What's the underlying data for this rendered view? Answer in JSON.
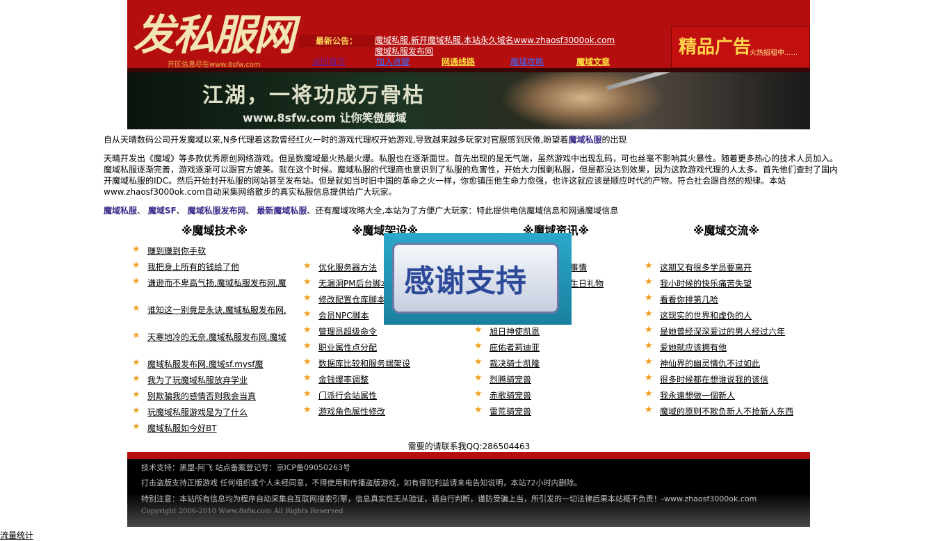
{
  "header": {
    "logo_text": "发私服网",
    "logo_sub": "开区信息尽在www.8sfw.com",
    "notice_label": "最新公告：",
    "notice_line1": "魔域私服,新开魔域私服,本站永久域名www.zhaosf3000ok.com",
    "notice_line2": "魔域私服发布网",
    "nav": [
      "返回首页",
      "加入收藏",
      "网通线路",
      "魔域攻略",
      "魔域文章"
    ],
    "ad_text": "精品广告",
    "ad_sub": "火热招租中......"
  },
  "banner": {
    "title": "江湖，一将功成万骨枯",
    "subtitle": "www.8sfw.com 让你笑傲魔域"
  },
  "intro": {
    "line1": "自从天晴数码公司开发魔域以来,N多代理着这款曾经红火一时的游戏代理权开始游戏,导致越来越多玩家对官服感到厌倦,盼望着",
    "line1_link": "魔域私服",
    "line1_end": "的出现",
    "para2": "天晴开发出《魔域》等多款优秀原创网络游戏。但是数魔域最火热最火爆。私服也在逐渐面世。首先出现的是无气端，虽然游戏中出现乱码，可也丝毫不影响其火暴性。随着更多热心的技术人员加入。魔域私服逐渐完善，游戏逐渐可以跟官方媲美。就在这个时候。魔域私服的代理商也意识到了私服的危害性，开始大力围剿私服，但是都没达到效果，因为这款游戏代理的人太多。首先他们查封了国内开魔域私服的IDC。然后开始封开私服的网站甚至发布站。但是就如当时旧中国的革命之火一样，你愈镇压他生命力愈强，也许这就应该是顺应时代的产物。符合社会跟自然的规律。本站www.zhaosf3000ok.com自动采集网络散步的真实私服信息提供给广大玩家。"
  },
  "links_line": {
    "l1": "魔域私服",
    "l2": "魔域SF",
    "l3": "魔域私服发布网",
    "l4": "最新魔域私服",
    "mid": "、还有",
    "l5": "魔域攻略",
    "end": "大全,本站为了方便广大玩家：特此提供电信魔域信息和网通魔域信息"
  },
  "columns": [
    {
      "title": "※魔域技术※",
      "items": [
        "赚到赚到你手软",
        "我把身上所有的钱给了他",
        "谦逊而不卑高气扬,魔域私服发布网,魔",
        "谁知这一别竟是永诀,魔域私服发布网,",
        "天寒地冷的无奈,魔域私服发布网,魔域",
        "魔域私服发布网,魔域sf.mysf魔",
        "我为了玩魔域私服放弃学业",
        "别欺骗我的感情否则我会当真",
        "玩魔域私服游戏是为了什么",
        "魔域私服如今好BT"
      ]
    },
    {
      "title": "※魔域架设※",
      "items": [
        "优化服务器方法",
        "无漏洞PM后台脚本",
        "修改配置仓库脚本",
        "会员NPC脚本",
        "管理员超级命令",
        "职业属性点分配",
        "数据库比较和服务端架设",
        "金钱爆率调整",
        "门派行会站属性",
        "游戏角色属性修改"
      ]
    },
    {
      "title": "※魔域资讯※",
      "items": [
        "事情",
        "生日礼物",
        "旭日神使凯恩",
        "庇佑者莉迪亚",
        "裁决骑士凯隆",
        "烈腾骑宠兽",
        "赤歌骑宠兽",
        "雷荒骑宠兽"
      ]
    },
    {
      "title": "※魔域交流※",
      "items": [
        "这期又有很多学员要离开",
        "我小时候的快乐痛苦失望",
        "看看你排第几哈",
        "这现实的世界和虚伪的人",
        "是她曾经深深爱过的男人经过六年",
        "爱她就应该拥有他",
        "神仙界的幽灵情仇不过如此",
        "很多时候都在想谁说我的该信",
        "我永遠想做一個新人",
        "魔域的原则不欺负新人不抢新人东西"
      ]
    }
  ],
  "popup": {
    "text": "感谢支持"
  },
  "contact": "需要的请联系我QQ:286504463",
  "footer": {
    "line1": "技术支持：黑盟-阿飞 站点备案登记号：京ICP备09050263号",
    "line2": "打击盗版支持正版游戏 任何组织或个人未经同意，不得使用和传播盗版游戏，如有侵犯利益请来电告知说明，本站72小时内删除。",
    "line3": "特别注意：本站所有信息均为程序自动采集自互联网搜索引擎，信息真实性无从验证，请自行判断，谨防受骗上当，所引发的一切法律后果本站概不负责！-www.zhaosf3000ok.com",
    "copyright": "Copyright 2006-2010 Www.8sfw.com All Rights Reserved"
  },
  "stats": "流量统计"
}
